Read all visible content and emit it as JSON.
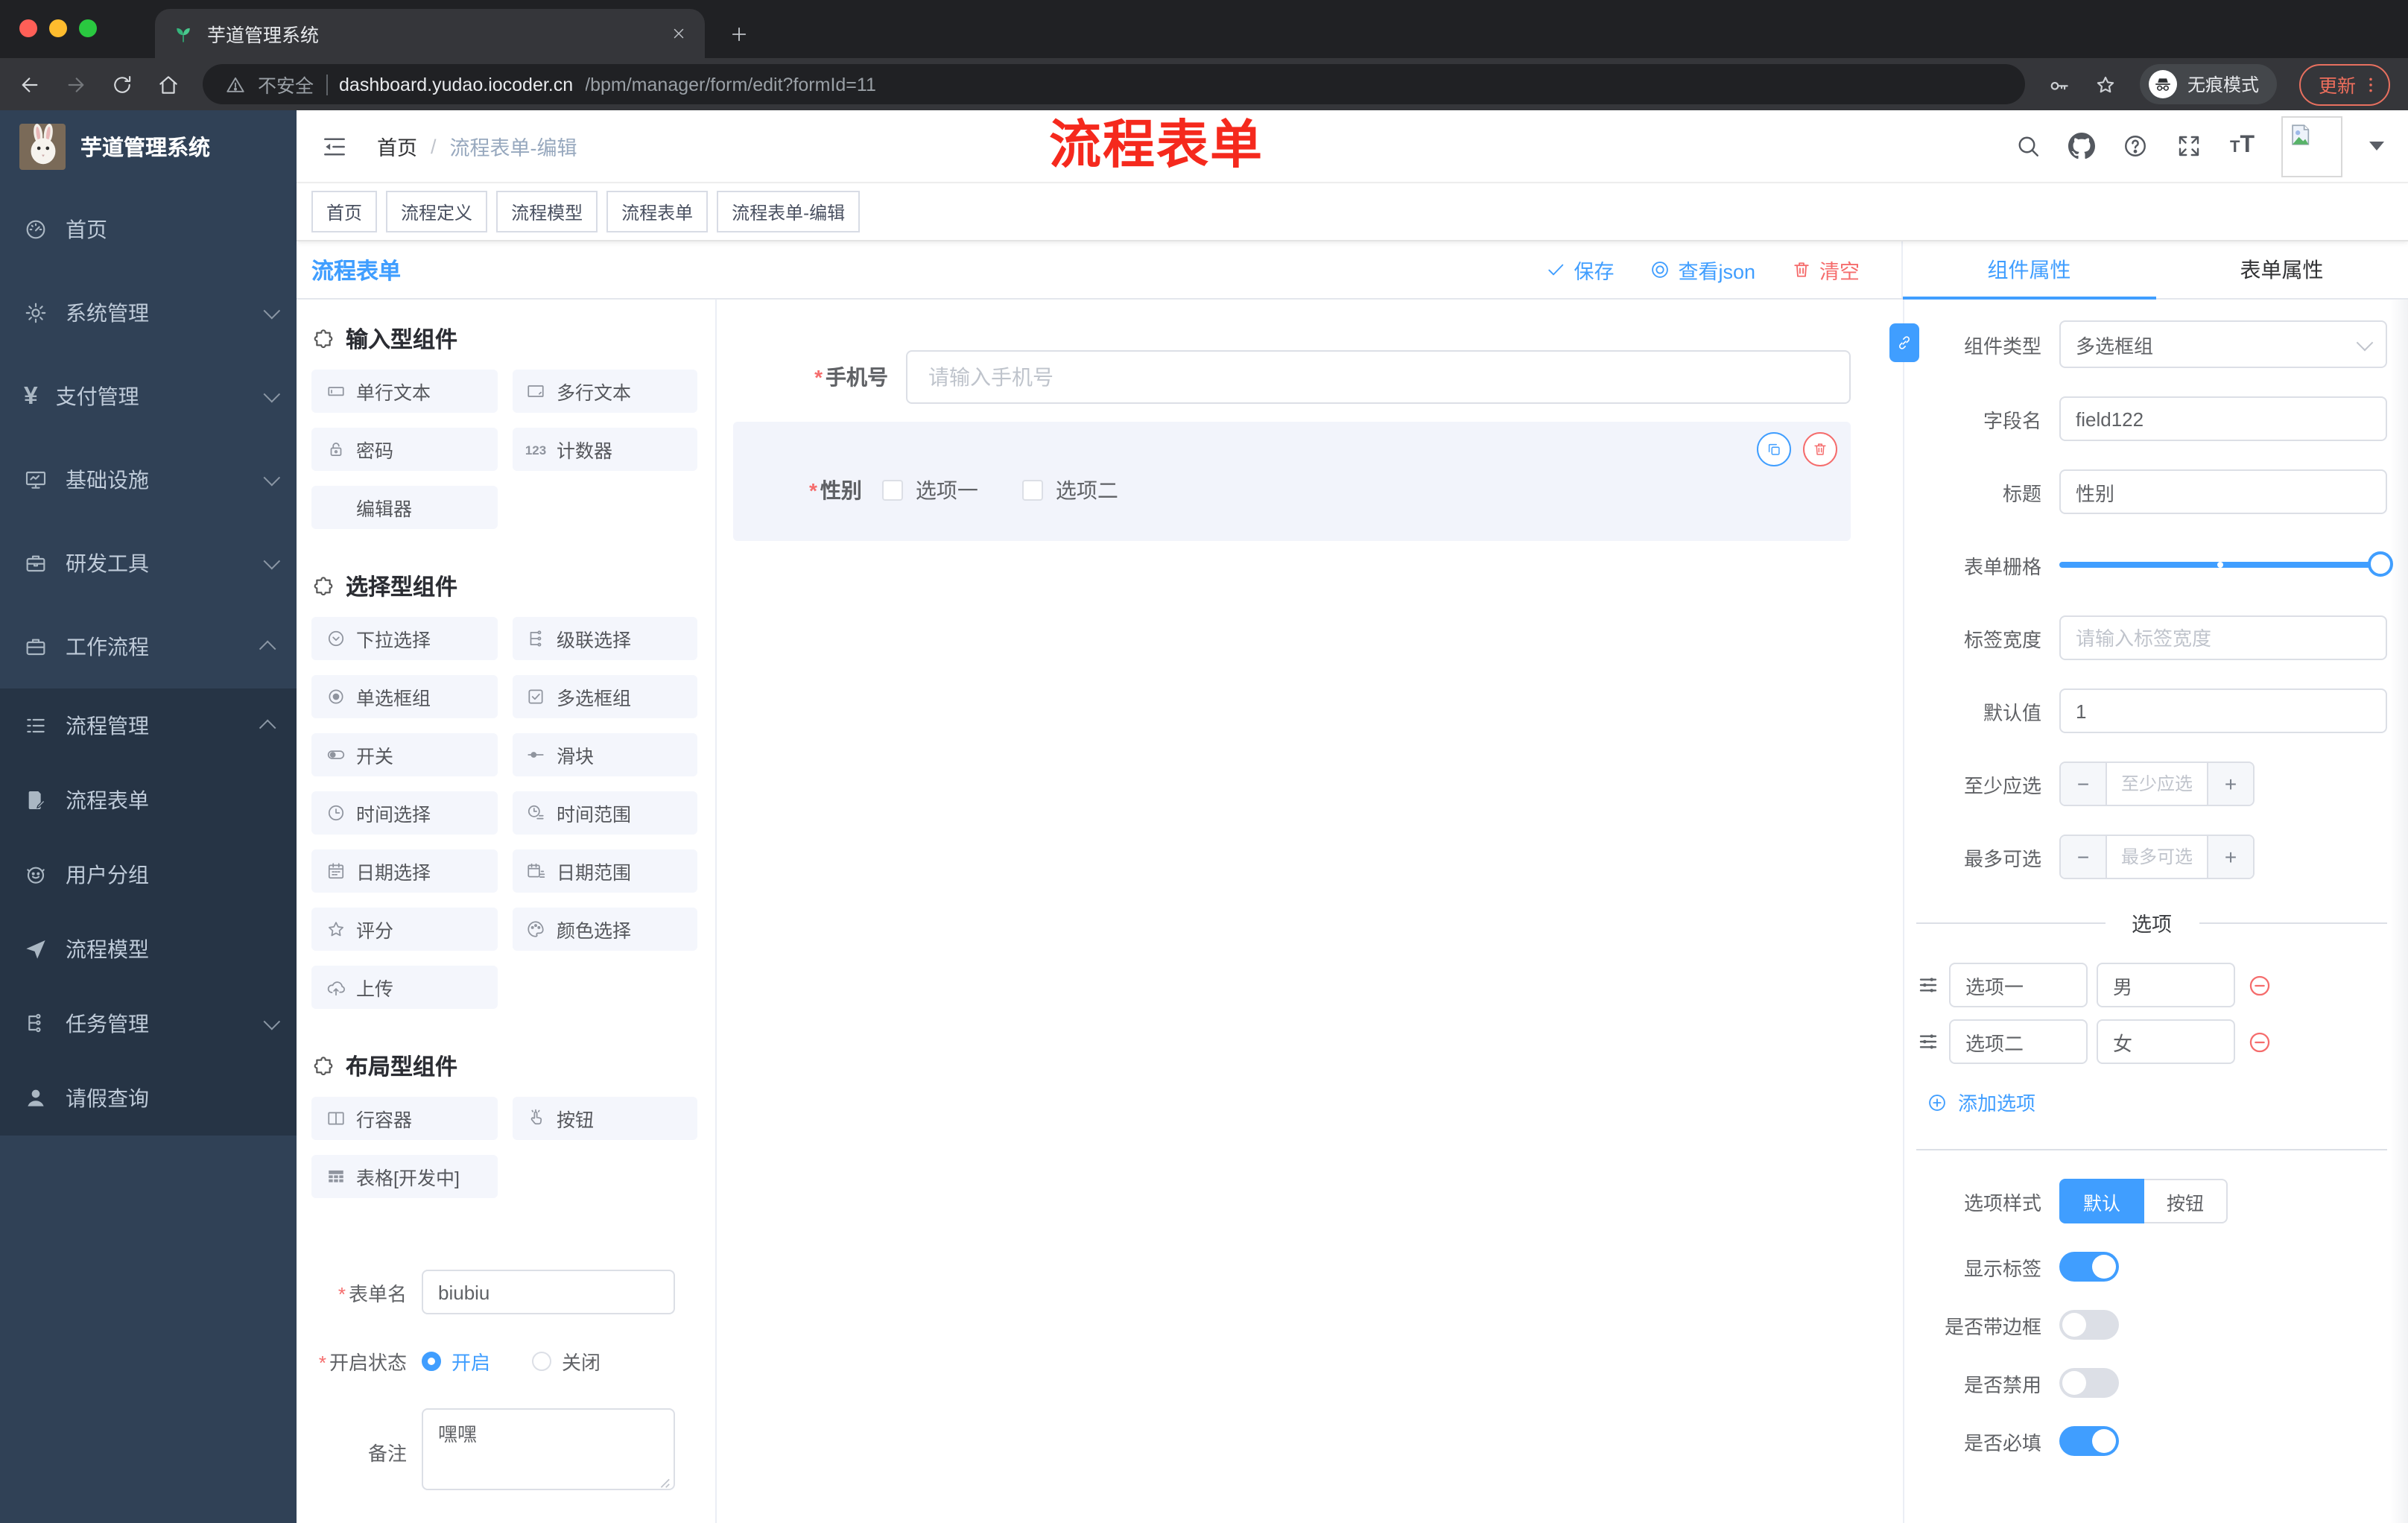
{
  "browser": {
    "tab_title": "芋道管理系统",
    "insecure": "不安全",
    "url_host": "dashboard.yudao.iocoder.cn",
    "url_path": "/bpm/manager/form/edit?formId=11",
    "incognito": "无痕模式",
    "update": "更新"
  },
  "sidebar": {
    "brand": "芋道管理系统",
    "items": [
      {
        "label": "首页",
        "icon": "dashboard-icon",
        "chev": ""
      },
      {
        "label": "系统管理",
        "icon": "gear-icon",
        "chev": "down"
      },
      {
        "label": "支付管理",
        "icon": "yen-icon",
        "chev": "down"
      },
      {
        "label": "基础设施",
        "icon": "monitor-icon",
        "chev": "down"
      },
      {
        "label": "研发工具",
        "icon": "toolbox-icon",
        "chev": "down"
      },
      {
        "label": "工作流程",
        "icon": "briefcase-icon",
        "chev": "up"
      }
    ],
    "submenu": [
      {
        "label": "流程管理",
        "icon": "flow-list-icon",
        "chev": "up",
        "cls": "lv1"
      },
      {
        "label": "流程表单",
        "icon": "doc-edit-icon",
        "chev": "",
        "cls": "lv2"
      },
      {
        "label": "用户分组",
        "icon": "user-group-icon",
        "chev": "",
        "cls": "lv2"
      },
      {
        "label": "流程模型",
        "icon": "send-icon",
        "chev": "",
        "cls": "lv2"
      },
      {
        "label": "任务管理",
        "icon": "tree-icon",
        "chev": "down",
        "cls": "lv1"
      },
      {
        "label": "请假查询",
        "icon": "person-icon",
        "chev": "",
        "cls": "lv1"
      }
    ]
  },
  "header": {
    "breadcrumb_home": "首页",
    "breadcrumb_sep": "/",
    "breadcrumb_current": "流程表单-编辑",
    "annotation": "流程表单",
    "annotation_color": "#f5291d"
  },
  "tags": [
    {
      "label": "首页",
      "cls": ""
    },
    {
      "label": "流程定义",
      "cls": "closable"
    },
    {
      "label": "流程模型",
      "cls": "closable"
    },
    {
      "label": "流程表单",
      "cls": "closable"
    },
    {
      "label": "流程表单-编辑",
      "cls": "active closable"
    }
  ],
  "toolbar": {
    "title": "流程表单",
    "save": "保存",
    "view_json": "查看json",
    "clear": "清空"
  },
  "palette": {
    "sections": [
      {
        "title": "输入型组件",
        "items": [
          {
            "icon": "input-icon",
            "label": "单行文本"
          },
          {
            "icon": "textarea-icon",
            "label": "多行文本"
          },
          {
            "icon": "password-icon",
            "label": "密码"
          },
          {
            "icon": "counter-icon",
            "label": "计数器"
          },
          {
            "icon": "blank-icon",
            "label": "编辑器"
          }
        ]
      },
      {
        "title": "选择型组件",
        "items": [
          {
            "icon": "select-icon",
            "label": "下拉选择"
          },
          {
            "icon": "cascader-icon",
            "label": "级联选择"
          },
          {
            "icon": "radio-group-icon",
            "label": "单选框组"
          },
          {
            "icon": "checkbox-group-icon",
            "label": "多选框组"
          },
          {
            "icon": "switch-icon",
            "label": "开关"
          },
          {
            "icon": "slider-icon",
            "label": "滑块"
          },
          {
            "icon": "time-icon",
            "label": "时间选择"
          },
          {
            "icon": "time-range-icon",
            "label": "时间范围"
          },
          {
            "icon": "date-icon",
            "label": "日期选择"
          },
          {
            "icon": "date-range-icon",
            "label": "日期范围"
          },
          {
            "icon": "rate-icon",
            "label": "评分"
          },
          {
            "icon": "color-icon",
            "label": "颜色选择"
          },
          {
            "icon": "upload-icon",
            "label": "上传"
          }
        ]
      },
      {
        "title": "布局型组件",
        "items": [
          {
            "icon": "row-icon",
            "label": "行容器"
          },
          {
            "icon": "button-icon",
            "label": "按钮"
          },
          {
            "icon": "table-icon",
            "label": "表格[开发中]"
          }
        ]
      }
    ],
    "form": {
      "name_label": "表单名",
      "name_value": "biubiu",
      "status_label": "开启状态",
      "status_on": "开启",
      "status_off": "关闭",
      "remark_label": "备注",
      "remark_value": "嘿嘿"
    }
  },
  "canvas": {
    "phone_label": "手机号",
    "phone_placeholder": "请输入手机号",
    "gender_label": "性别",
    "gender_options": [
      "选项一",
      "选项二"
    ]
  },
  "panel": {
    "tabs": [
      "组件属性",
      "表单属性"
    ],
    "type_label": "组件类型",
    "type_value": "多选框组",
    "field_label": "字段名",
    "field_value": "field122",
    "title_label": "标题",
    "title_value": "性别",
    "grid_label": "表单栅格",
    "width_label": "标签宽度",
    "width_placeholder": "请输入标签宽度",
    "default_label": "默认值",
    "default_value": "1",
    "min_label": "至少应选",
    "min_placeholder": "至少应选",
    "max_label": "最多可选",
    "max_placeholder": "最多可选",
    "options_divider": "选项",
    "options": [
      {
        "label": "选项一",
        "value": "男"
      },
      {
        "label": "选项二",
        "value": "女"
      }
    ],
    "add_option": "添加选项",
    "style_label": "选项样式",
    "style_choices": [
      "默认",
      "按钮"
    ],
    "style_selected": "默认",
    "switches": [
      {
        "label": "显示标签",
        "cls": "on"
      },
      {
        "label": "是否带边框",
        "cls": ""
      },
      {
        "label": "是否禁用",
        "cls": ""
      },
      {
        "label": "是否必填",
        "cls": "on"
      }
    ],
    "accent_color": "#409eff"
  }
}
